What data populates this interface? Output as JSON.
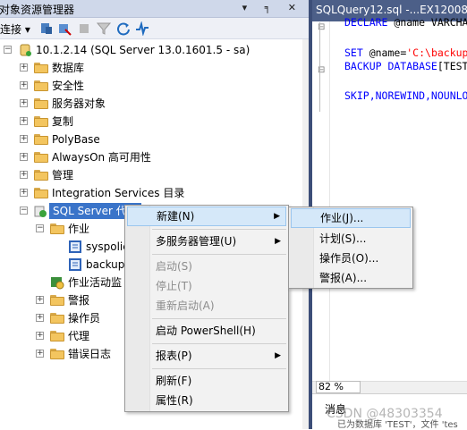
{
  "explorer": {
    "title": "对象资源管理器",
    "pin_icons": "▾ ╕ ✕",
    "toolbar": {
      "connect_label": "连接 ▾"
    }
  },
  "tree": {
    "server": "10.1.2.14 (SQL Server 13.0.1601.5 - sa)",
    "folders": [
      "数据库",
      "安全性",
      "服务器对象",
      "复制",
      "PolyBase",
      "AlwaysOn 高可用性",
      "管理",
      "Integration Services 目录"
    ],
    "agent": "SQL Server 代理",
    "jobs": "作业",
    "job_items": [
      "syspolic",
      "backup"
    ],
    "job_monitor": "作业活动监",
    "agent_folders": [
      "警报",
      "操作员",
      "代理",
      "错误日志"
    ]
  },
  "context_menu": {
    "items": [
      {
        "label": "新建(N)",
        "submenu": true,
        "highlighted": true
      },
      {
        "label": "多服务器管理(U)",
        "submenu": true
      },
      {
        "label": "启动(S)",
        "disabled": true
      },
      {
        "label": "停止(T)",
        "disabled": true
      },
      {
        "label": "重新启动(A)",
        "disabled": true
      },
      {
        "label": "启动 PowerShell(H)"
      },
      {
        "label": "报表(P)",
        "submenu": true
      },
      {
        "label": "刷新(F)"
      },
      {
        "label": "属性(R)"
      }
    ]
  },
  "submenu": {
    "items": [
      "作业(J)...",
      "计划(S)...",
      "操作员(O)...",
      "警报(A)..."
    ]
  },
  "editor": {
    "tab_title": "SQLQuery12.sql -...EX12008 (",
    "lines": {
      "l1_kw": "DECLARE",
      "l1_rest": " @name VARCHA",
      "l2_kw": "SET",
      "l2_rest": " @name=",
      "l2_str": "'C:\\backup",
      "l3_kw": "BACKUP DATABASE",
      "l3_rest": "[TEST",
      "l4_kw": "SKIP,NOREWIND,NOUNLO"
    },
    "zoom": "82 %",
    "messages_tab": "消息",
    "message_text": "已为数据库 'TEST'，文件 'tes",
    "watermark": "CSDN @48303354"
  }
}
